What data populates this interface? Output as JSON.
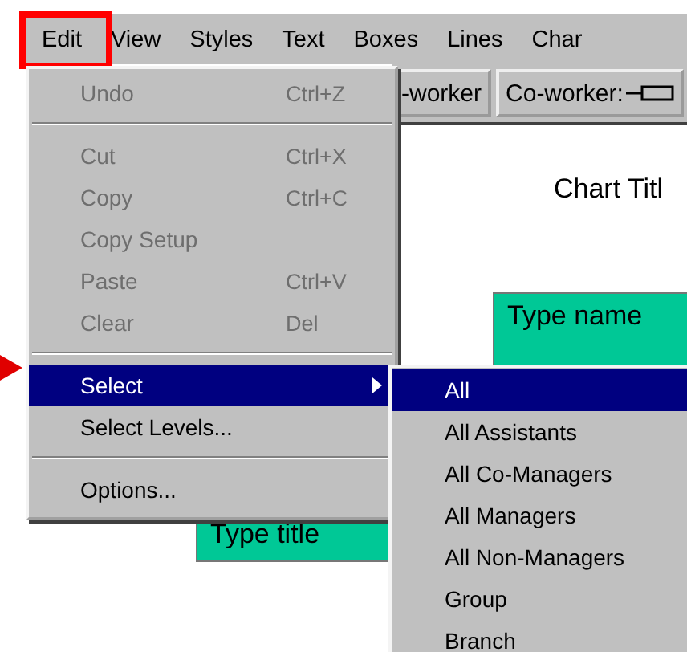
{
  "menu_bar": [
    {
      "label": "Edit"
    },
    {
      "label": "View"
    },
    {
      "label": "Styles"
    },
    {
      "label": "Text"
    },
    {
      "label": "Boxes"
    },
    {
      "label": "Lines"
    },
    {
      "label": "Char"
    }
  ],
  "toolbar": [
    {
      "label": "-worker"
    },
    {
      "label": "Co-worker:"
    }
  ],
  "chart": {
    "title": "Chart Titl",
    "boxes": [
      {
        "text": "Type name"
      },
      {
        "text": "Type title"
      }
    ]
  },
  "edit_menu": [
    {
      "kind": "item",
      "label": "Undo",
      "shortcut": "Ctrl+Z",
      "disabled": true,
      "selected": false
    },
    {
      "kind": "separator"
    },
    {
      "kind": "item",
      "label": "Cut",
      "shortcut": "Ctrl+X",
      "disabled": true,
      "selected": false
    },
    {
      "kind": "item",
      "label": "Copy",
      "shortcut": "Ctrl+C",
      "disabled": true,
      "selected": false
    },
    {
      "kind": "item",
      "label": "Copy Setup",
      "disabled": true,
      "selected": false
    },
    {
      "kind": "item",
      "label": "Paste",
      "shortcut": "Ctrl+V",
      "disabled": true,
      "selected": false
    },
    {
      "kind": "item",
      "label": "Clear",
      "shortcut": "Del",
      "disabled": true,
      "selected": false
    },
    {
      "kind": "separator"
    },
    {
      "kind": "submenu",
      "label": "Select",
      "disabled": false,
      "selected": true
    },
    {
      "kind": "item",
      "label": "Select Levels...",
      "disabled": false,
      "selected": false
    },
    {
      "kind": "separator"
    },
    {
      "kind": "item",
      "label": "Options...",
      "disabled": false,
      "selected": false
    }
  ],
  "select_submenu": [
    {
      "label": "All",
      "selected": true
    },
    {
      "label": "All Assistants",
      "selected": false
    },
    {
      "label": "All Co-Managers",
      "selected": false
    },
    {
      "label": "All Managers",
      "selected": false
    },
    {
      "label": "All Non-Managers",
      "selected": false
    },
    {
      "label": "Group",
      "selected": false
    },
    {
      "label": "Branch",
      "selected": false
    }
  ]
}
